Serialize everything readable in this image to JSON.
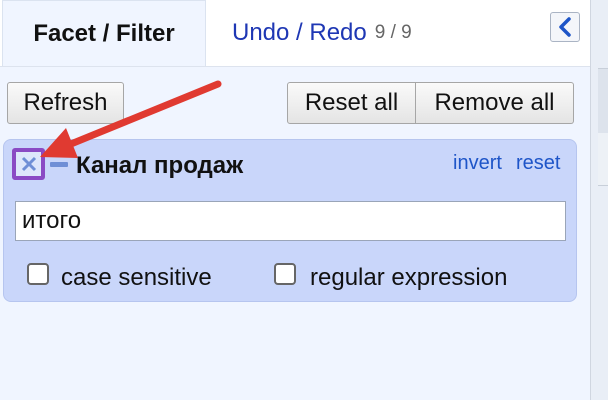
{
  "tabs": {
    "facet_filter": "Facet / Filter",
    "undo_redo": "Undo / Redo",
    "undo_count": "9 / 9"
  },
  "toolbar": {
    "refresh": "Refresh",
    "reset_all": "Reset all",
    "remove_all": "Remove all"
  },
  "facet": {
    "title": "Канал продаж",
    "invert": "invert",
    "reset": "reset",
    "search_value": "итого",
    "case_sensitive": "case sensitive",
    "regular_expression": "regular expression",
    "case_sensitive_checked": false,
    "regular_expression_checked": false
  },
  "icons": {
    "collapse": "chevron-left-icon",
    "remove": "close-icon",
    "minimize": "minimize-icon",
    "annotation": "red-arrow"
  },
  "colors": {
    "panel_bg": "#f0f5ff",
    "facet_bg": "#c9d6fa",
    "link": "#1e55c8",
    "tab_link": "#1e37b4",
    "highlight": "#8a4ac4",
    "arrow": "#e03a31"
  }
}
